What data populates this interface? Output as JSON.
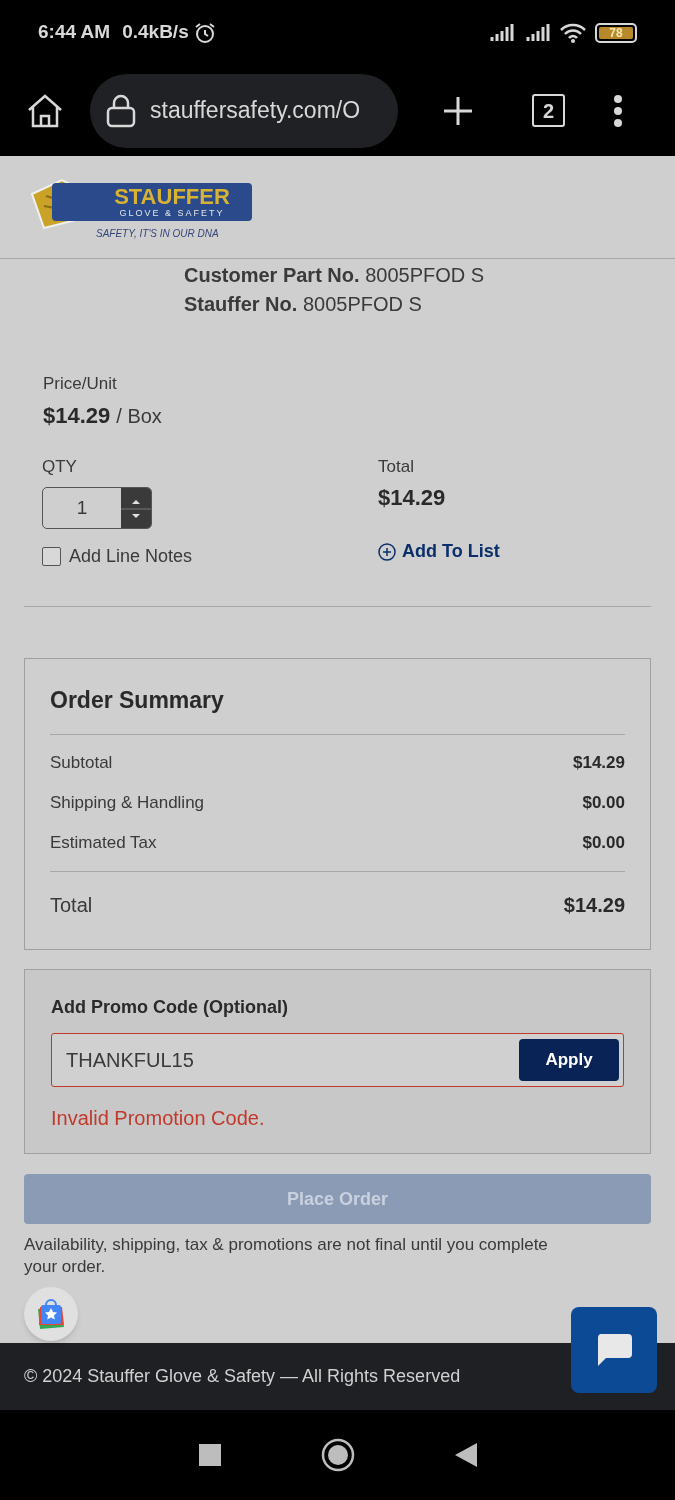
{
  "status_bar": {
    "time": "6:44 AM",
    "speed": "0.4kB/s",
    "battery": "78"
  },
  "browser": {
    "url": "stauffersafety.com/O",
    "tab_count": "2"
  },
  "logo": {
    "name": "STAUFFER",
    "sub": "GLOVE & SAFETY",
    "tagline": "SAFETY, IT'S IN OUR DNA"
  },
  "part_info": [
    {
      "label": "Customer Part No.",
      "value": "8005PFOD S"
    },
    {
      "label": "Stauffer No.",
      "value": "8005PFOD S"
    }
  ],
  "price": {
    "label": "Price/Unit",
    "amount": "$14.29",
    "unit": "/ Box"
  },
  "qty": {
    "label": "QTY",
    "value": "1"
  },
  "total": {
    "label": "Total",
    "amount": "$14.29"
  },
  "add_line_notes": {
    "label": "Add Line Notes",
    "checked": false
  },
  "add_to_list": "Add To List",
  "order_summary": {
    "title": "Order Summary",
    "lines": [
      {
        "label": "Subtotal",
        "value": "$14.29"
      },
      {
        "label": "Shipping & Handling",
        "value": "$0.00"
      },
      {
        "label": "Estimated Tax",
        "value": "$0.00"
      }
    ],
    "total": {
      "label": "Total",
      "value": "$14.29"
    }
  },
  "promo": {
    "title": "Add Promo Code (Optional)",
    "value": "THANKFUL15",
    "button": "Apply",
    "error": "Invalid Promotion Code."
  },
  "place_order": {
    "label": "Place Order",
    "disabled": true
  },
  "disclaimer": "Availability, shipping, tax & promotions are not final until you complete your order.",
  "footer": "© 2024 Stauffer Glove & Safety — All Rights Reserved"
}
